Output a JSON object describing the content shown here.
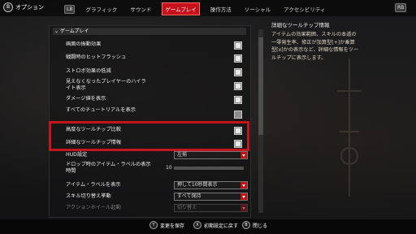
{
  "top": {
    "back_label": "オプション",
    "back_icon": "b-button-icon",
    "lb": "LB",
    "rb": "RB",
    "tabs": [
      "グラフィック",
      "サウンド",
      "ゲームプレイ",
      "操作方法",
      "ソーシャル",
      "アクセシビリティ"
    ],
    "active_tab_index": 2
  },
  "section": {
    "header": "ゲームプレイ"
  },
  "rows": [
    {
      "label": "画面の振動効果",
      "type": "checkbox",
      "checked": true
    },
    {
      "label": "戦闘時のヒットフラッシュ",
      "type": "checkbox",
      "checked": true
    },
    {
      "label": "ストロボ効果の低減",
      "type": "checkbox",
      "checked": true
    },
    {
      "label": "見えなくなったプレイヤーのハイライト表示",
      "type": "checkbox",
      "checked": true
    },
    {
      "label": "ダメージ値を表示",
      "type": "checkbox",
      "checked": true
    },
    {
      "label": "すべてのチュートリアルを表示",
      "type": "checkbox",
      "checked": false
    },
    {
      "label": "高度なツールチップ比較",
      "type": "checkbox",
      "checked": true
    },
    {
      "label": "詳細なツールチップ情報",
      "type": "checkbox",
      "checked": true
    },
    {
      "label": "HUD設定",
      "type": "select",
      "value": "左揃"
    },
    {
      "label": "ドロップ時のアイテム・ラベルの表示時間",
      "type": "slider",
      "value": "10"
    },
    {
      "label": "アイテム・ラベルを表示",
      "type": "select",
      "value": "押して10秒間表示"
    },
    {
      "label": "スキル切り替え挙動",
      "type": "select",
      "value": "すべて保持"
    },
    {
      "label": "アクションホイール起動",
      "type": "select",
      "value": "切り替え"
    }
  ],
  "description": {
    "title": "詳細なツールチップ情報",
    "body": "アイテムの効果範囲、スキルの本道の一零発生率、修正が加算型[+]か乗算型[x]かの表示など、詳細な情報をツールチップに表示します。"
  },
  "bottom": {
    "save_label": "変更を保存",
    "reset_label": "初期設定に戻す",
    "close_label": "閉じる",
    "save_icon": "y-button-icon",
    "reset_icon": "x-button-icon",
    "close_icon": "b-button-icon"
  },
  "colors": {
    "accent": "#c8101a",
    "panel": "#141416"
  }
}
